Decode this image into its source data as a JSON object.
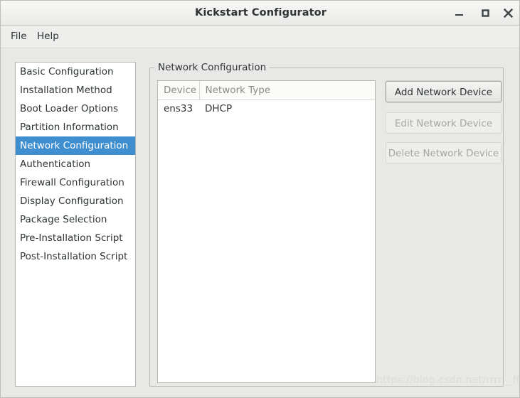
{
  "window": {
    "title": "Kickstart Configurator",
    "controls": [
      {
        "name": "minimize",
        "glyph": "minimize-icon"
      },
      {
        "name": "maximize",
        "glyph": "maximize-icon"
      },
      {
        "name": "close",
        "glyph": "close-icon"
      }
    ]
  },
  "menubar": {
    "items": [
      {
        "label": "File"
      },
      {
        "label": "Help"
      }
    ]
  },
  "sidebar": {
    "selected_index": 4,
    "items": [
      {
        "label": "Basic Configuration"
      },
      {
        "label": "Installation Method"
      },
      {
        "label": "Boot Loader Options"
      },
      {
        "label": "Partition Information"
      },
      {
        "label": "Network Configuration"
      },
      {
        "label": "Authentication"
      },
      {
        "label": "Firewall Configuration"
      },
      {
        "label": "Display Configuration"
      },
      {
        "label": "Package Selection"
      },
      {
        "label": "Pre-Installation Script"
      },
      {
        "label": "Post-Installation Script"
      }
    ]
  },
  "main": {
    "groupbox_title": "Network Configuration",
    "table": {
      "columns": [
        "Device",
        "Network Type"
      ],
      "rows": [
        {
          "device": "ens33",
          "network_type": "DHCP"
        }
      ]
    },
    "buttons": [
      {
        "label": "Add Network Device",
        "enabled": true
      },
      {
        "label": "Edit Network Device",
        "enabled": false
      },
      {
        "label": "Delete Network Device",
        "enabled": false
      }
    ]
  },
  "watermark": {
    "text": "https://blog.csdn.net/rrrr__ffff"
  },
  "colors": {
    "selection_blue": "#3e8ed0",
    "window_bg": "#e8e8e6",
    "text": "#2e3436",
    "muted_text": "#8a8a86",
    "disabled_text": "#a6a6a2"
  }
}
